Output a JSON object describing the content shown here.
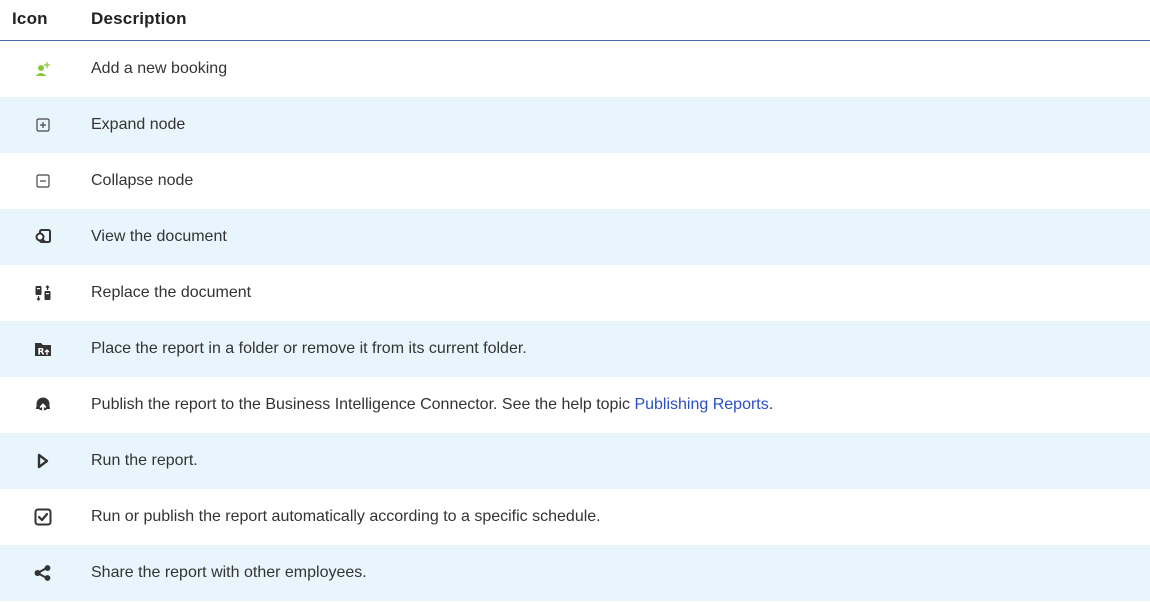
{
  "header": {
    "icon_label": "Icon",
    "description_label": "Description"
  },
  "rows": [
    {
      "icon": "add-person-icon",
      "description": "Add a new booking"
    },
    {
      "icon": "expand-node-icon",
      "description": "Expand node"
    },
    {
      "icon": "collapse-node-icon",
      "description": "Collapse node"
    },
    {
      "icon": "view-document-icon",
      "description": "View the document"
    },
    {
      "icon": "replace-document-icon",
      "description": "Replace the document"
    },
    {
      "icon": "report-folder-icon",
      "description": "Place the report in a folder or remove it from its current folder."
    },
    {
      "icon": "publish-cloud-icon",
      "description_before": "Publish the report to the Business Intelligence Connector. See the help topic ",
      "link": "Publishing Reports",
      "description_after": "."
    },
    {
      "icon": "run-play-icon",
      "description": "Run the report."
    },
    {
      "icon": "schedule-check-icon",
      "description": "Run or publish the report automatically according to a specific schedule."
    },
    {
      "icon": "share-icon",
      "description": "Share the report with other employees."
    }
  ],
  "colors": {
    "header_rule": "#4a63b5",
    "alt_row": "#e9f5fd",
    "link": "#2b4fc7",
    "add_icon": "#8cc63f"
  }
}
